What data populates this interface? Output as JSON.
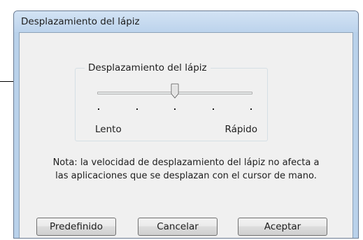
{
  "window": {
    "title": "Desplazamiento del lápiz"
  },
  "group": {
    "label": "Desplazamiento del lápiz"
  },
  "slider": {
    "tick_count": 5,
    "selected_tick": 3,
    "min_label": "Lento",
    "max_label": "Rápido"
  },
  "note": {
    "line1": "Nota: la velocidad de desplazamiento del lápiz no afecta a",
    "line2": "las aplicaciones que se desplazan con el cursor de mano."
  },
  "buttons": {
    "default_label": "Predefinido",
    "cancel_label": "Cancelar",
    "ok_label": "Aceptar"
  },
  "colors": {
    "window_frame": "#b9d1ea",
    "dialog_background": "#f0f0f0"
  }
}
